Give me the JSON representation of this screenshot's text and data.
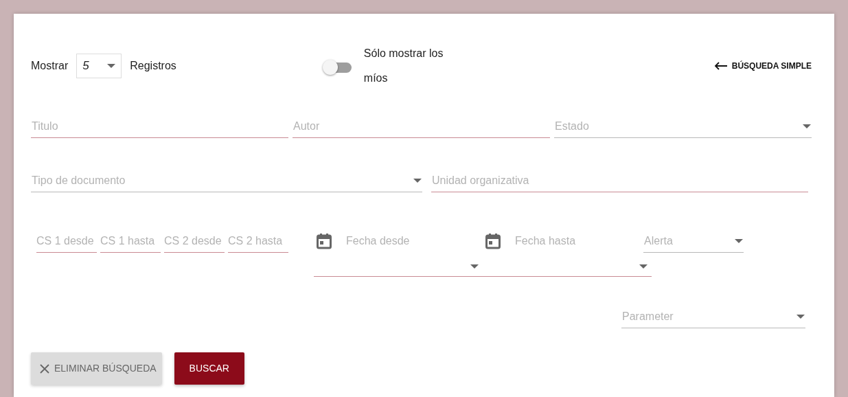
{
  "records": {
    "label": "Mostrar",
    "value": "5",
    "suffix": "Registros"
  },
  "only_mine": {
    "label": "Sólo mostrar los míos",
    "on": false
  },
  "simple_search_link": "BÚSQUEDA SIMPLE",
  "field_rows": [
    [
      {
        "kind": "text",
        "placeholder": "Titulo"
      },
      {
        "kind": "text",
        "placeholder": "Autor"
      },
      {
        "kind": "select",
        "placeholder": "Estado"
      }
    ],
    [
      {
        "kind": "select",
        "placeholder": "Tipo de documento"
      },
      {
        "kind": "text",
        "placeholder": "Unidad organizativa"
      }
    ]
  ],
  "range_fields": [
    {
      "placeholder": "CS 1 desde"
    },
    {
      "placeholder": "CS 1 hasta"
    },
    {
      "placeholder": "CS 2 desde"
    },
    {
      "placeholder": "CS 2 hasta"
    }
  ],
  "date_fields": [
    {
      "placeholder": "Fecha desde"
    },
    {
      "placeholder": "Fecha hasta"
    }
  ],
  "alert_select": {
    "placeholder": "Alerta"
  },
  "parameter_select": {
    "placeholder": "Parameter"
  },
  "buttons": [
    {
      "kind": "clear",
      "label": "ELIMINAR BÚSQUEDA"
    },
    {
      "kind": "primary",
      "label": "BUSCAR"
    }
  ]
}
